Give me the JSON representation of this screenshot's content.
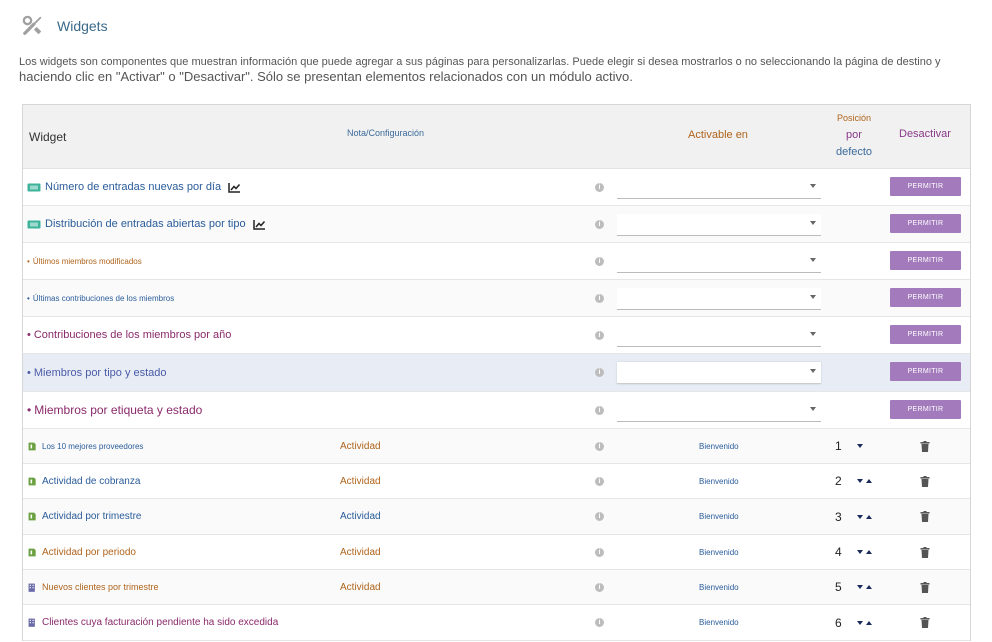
{
  "page": {
    "title": "Widgets",
    "intro_line1": "Los widgets son componentes que muestran información que puede agregar a sus páginas para personalizarlas. Puede elegir si desea mostrarlos o no seleccionando la página de destino y",
    "intro_line2": "haciendo clic en \"Activar\" o \"Desactivar\". Sólo se presentan elementos relacionados con un módulo activo."
  },
  "table": {
    "headers": {
      "widget": "Widget",
      "nota": "Nota/Configuración",
      "activable": "Activable en",
      "pos1": "Posición",
      "pos2": "por",
      "pos3": "defecto",
      "desactivar": "Desactivar"
    },
    "inactive_rows": [
      {
        "label": "Número de entradas nuevas por día",
        "icon": "ticket-icon",
        "chart": true,
        "color": "#2a5c9a",
        "size": "11px"
      },
      {
        "label": "Distribución de entradas abiertas por tipo",
        "icon": "ticket-icon",
        "chart": true,
        "color": "#2a5c9a",
        "size": "11px"
      },
      {
        "label": "Últimos miembros modificados",
        "bullet": "•",
        "color": "#b0641c",
        "size": "8px"
      },
      {
        "label": "Últimas contribuciones de los miembros",
        "bullet": "•",
        "color": "#2a5c9a",
        "size": "8px"
      },
      {
        "label": "Contribuciones de los miembros por año",
        "bullet": "•",
        "color": "#8a2a6a",
        "size": "11px"
      },
      {
        "label": "Miembros por tipo y estado",
        "bullet": "•",
        "color": "#4a5aa8",
        "size": "11px"
      },
      {
        "label": "Miembros por etiqueta y estado",
        "bullet": "•",
        "color": "#8a2a6a",
        "size": "12px"
      }
    ],
    "permit_label": "PERMITIR",
    "active_rows": [
      {
        "label": "Los 10 mejores proveedores",
        "icon": "invoice-icon",
        "nota": "Actividad",
        "nota_color": "#b0641c",
        "activable": "Bienvenido",
        "pos": "1",
        "up": false,
        "down": true,
        "color": "#2a5c9a",
        "size": "8px"
      },
      {
        "label": "Actividad de cobranza",
        "icon": "invoice-icon",
        "nota": "Actividad",
        "nota_color": "#b0641c",
        "activable": "Bienvenido",
        "pos": "2",
        "up": true,
        "down": true,
        "color": "#2a5c9a",
        "size": "10px"
      },
      {
        "label": "Actividad por trimestre",
        "icon": "invoice-icon",
        "nota": "Actividad",
        "nota_color": "#2a5c9a",
        "activable": "Bienvenido",
        "pos": "3",
        "up": true,
        "down": true,
        "color": "#2a5c9a",
        "size": "10px"
      },
      {
        "label": "Actividad por periodo",
        "icon": "invoice-icon",
        "nota": "Actividad",
        "nota_color": "#b0641c",
        "activable": "Bienvenido",
        "pos": "4",
        "up": true,
        "down": true,
        "color": "#b0641c",
        "size": "10px"
      },
      {
        "label": "Nuevos clientes por trimestre",
        "icon": "building-icon",
        "nota": "Actividad",
        "nota_color": "#b0641c",
        "activable": "Bienvenido",
        "pos": "5",
        "up": true,
        "down": true,
        "color": "#b0641c",
        "size": "9px"
      },
      {
        "label": "Clientes cuya facturación pendiente ha sido excedida",
        "icon": "building-icon",
        "nota": "",
        "nota_color": "#b0641c",
        "activable": "Bienvenido",
        "pos": "6",
        "up": true,
        "down": true,
        "color": "#8a2a6a",
        "size": "10px"
      }
    ]
  },
  "colors": {
    "ticket": "#3cb39a",
    "invoice": "#6aa040",
    "building": "#6a6aa8",
    "button": "#a37bbd"
  }
}
